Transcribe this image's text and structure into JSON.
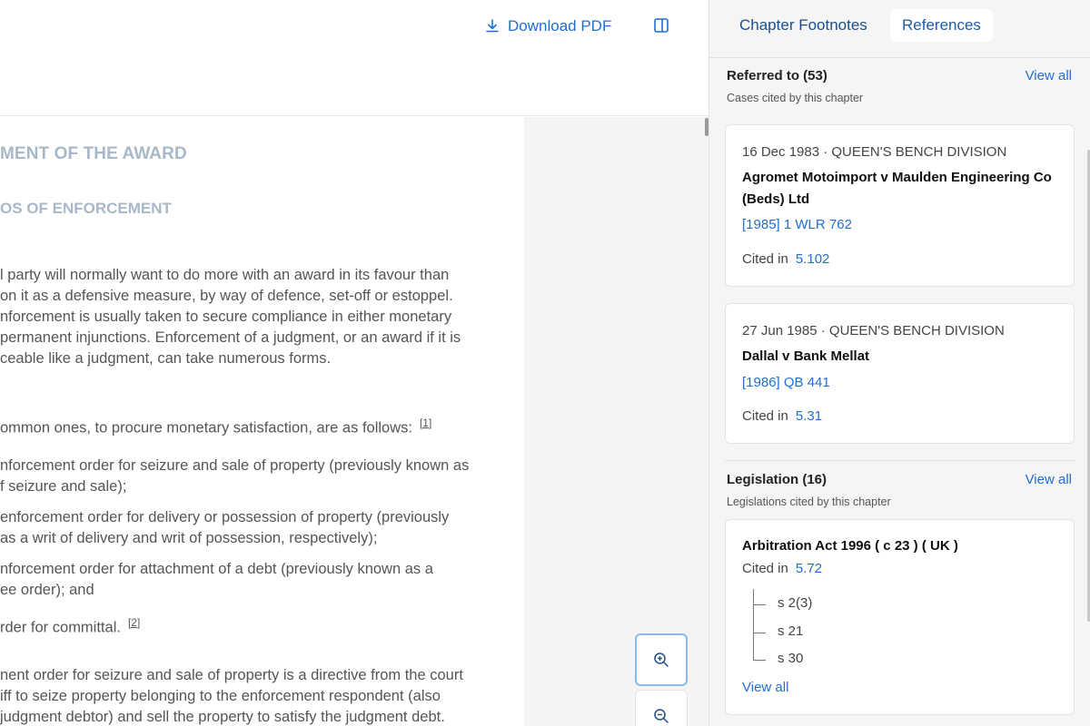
{
  "toolbar": {
    "download_label": "Download PDF"
  },
  "document": {
    "heading_main": "MENT OF THE AWARD",
    "heading_sub": "OS OF ENFORCEMENT",
    "paragraph_1_lines": [
      "l party will normally want to do more with an award in its favour than",
      " on it as a defensive measure, by way of defence, set-off or estoppel.",
      "nforcement is usually taken to secure compliance in either monetary",
      " permanent injunctions. Enforcement of a judgment, or an award if it is",
      "ceable like a judgment, can take numerous forms."
    ],
    "paragraph_2": "ommon ones, to procure monetary satisfaction, are as follows:",
    "footnote_1": "[1]",
    "list_items": [
      [
        "nforcement order for seizure and sale of property (previously known as",
        "f seizure and sale);"
      ],
      [
        "enforcement order for delivery or possession of property (previously",
        "as a writ of delivery and writ of possession, respectively);"
      ],
      [
        "nforcement order for attachment of a debt (previously known as a",
        "ee order); and"
      ],
      [
        "rder for committal."
      ]
    ],
    "footnote_2": "[2]",
    "paragraph_3_lines": [
      "nent order for seizure and sale of property is a directive from the court",
      "iff to seize property belonging to the enforcement respondent (also",
      " judgment debtor) and sell the property to satisfy the judgment debt."
    ]
  },
  "sidebar": {
    "tabs": [
      {
        "label": "Chapter Footnotes",
        "active": false
      },
      {
        "label": "References",
        "active": true
      }
    ],
    "referred": {
      "title": "Referred to (53)",
      "subtitle": "Cases cited by this chapter",
      "view_all": "View all",
      "cards": [
        {
          "date": "16 Dec 1983",
          "court": "QUEEN'S BENCH DIVISION",
          "meta": "16 Dec 1983  · QUEEN'S BENCH DIVISION",
          "title": "Agromet Motoimport v Maulden Engineering Co (Beds) Ltd",
          "citation": "[1985] 1 WLR 762",
          "cited_label": "Cited in",
          "cited_ref": "5.102"
        },
        {
          "date": "27 Jun 1985",
          "court": "QUEEN'S BENCH DIVISION",
          "meta": "27 Jun 1985  · QUEEN'S BENCH DIVISION",
          "title": "Dallal v Bank Mellat",
          "citation": "[1986] QB 441",
          "cited_label": "Cited in",
          "cited_ref": "5.31"
        }
      ]
    },
    "legislation": {
      "title": "Legislation (16)",
      "subtitle": "Legislations cited by this chapter",
      "view_all": "View all",
      "card": {
        "title": "Arbitration Act 1996 ( c 23 ) ( UK )",
        "cited_label": "Cited in",
        "cited_ref": "5.72",
        "sections": [
          "s 2(3)",
          "s 21",
          "s 30"
        ],
        "view_all": "View all"
      }
    }
  },
  "colors": {
    "accent": "#1f6fd1",
    "zoom_focus": "#8ab8ec",
    "panel_bg": "#f5f5f5"
  }
}
